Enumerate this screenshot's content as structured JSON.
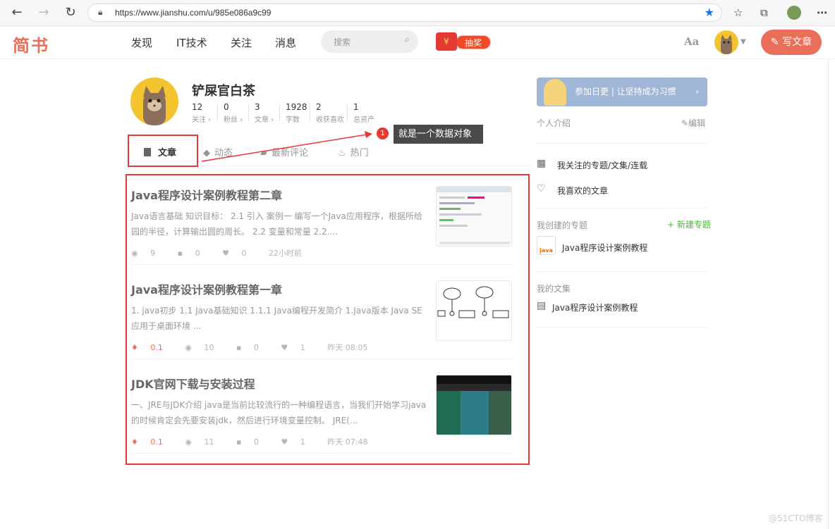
{
  "browser": {
    "url": "https://www.jianshu.com/u/985e086a9c99"
  },
  "nav": {
    "logo": "简书",
    "items": [
      "发现",
      "IT技术",
      "关注",
      "消息"
    ],
    "search_placeholder": "搜索",
    "lottery": "抽奖",
    "font_toggle": "Aa",
    "write": "写文章"
  },
  "profile": {
    "name": "铲屎官白茶",
    "stats": [
      {
        "num": "12",
        "label": "关注 ›"
      },
      {
        "num": "0",
        "label": "粉丝 ›"
      },
      {
        "num": "3",
        "label": "文章 ›"
      },
      {
        "num": "1928",
        "label": "字数"
      },
      {
        "num": "2",
        "label": "收获喜欢"
      },
      {
        "num": "1",
        "label": "总资产"
      }
    ]
  },
  "tabs": [
    "文章",
    "动态",
    "最新评论",
    "热门"
  ],
  "annotation": {
    "badge": "1",
    "text": "就是一个数据对象"
  },
  "articles": [
    {
      "title": "Java程序设计案例教程第二章",
      "abstract": "Java语言基础 知识目标： 2.1 引入 案例一 编写一个Java应用程序，根据所给园的半径，计算输出圆的周长。 2.2 变量和常量 2.2....",
      "views": "9",
      "comments": "0",
      "likes": "0",
      "time": "22小时前",
      "jewel": ""
    },
    {
      "title": "Java程序设计案例教程第一章",
      "abstract": "1. java初步 1.1 Java基础知识 1.1.1 Java编程开发简介 1.Java版本 Java SE 应用于桌面环境 ...",
      "jewel": "0.1",
      "views": "10",
      "comments": "0",
      "likes": "1",
      "time": "昨天 08:05"
    },
    {
      "title": "JDK官网下载与安装过程",
      "abstract": "一、JRE与JDK介绍 java是当前比较流行的一种编程语言，当我们开始学习java的时候肯定会先要安装jdk，然后进行环境变量控制。 JRE(...",
      "jewel": "0.1",
      "views": "11",
      "comments": "0",
      "likes": "1",
      "time": "昨天 07:48"
    }
  ],
  "sidebar": {
    "banner": "参加日更 | 让坚持成为习惯",
    "intro_label": "个人介绍",
    "edit": "编辑",
    "followed_topics": "我关注的专题/文集/连载",
    "liked_articles": "我喜欢的文章",
    "created_topics_label": "我创建的专题",
    "new_topic": "+ 新建专题",
    "topic_name": "Java程序设计案例教程",
    "anthology_label": "我的文集",
    "anthology_name": "Java程序设计案例教程"
  },
  "watermark": "@51CTO博客",
  "colors": {
    "brand": "#ea6f5a",
    "highlight_box": "#e53935",
    "new_topic": "#42c02e"
  }
}
